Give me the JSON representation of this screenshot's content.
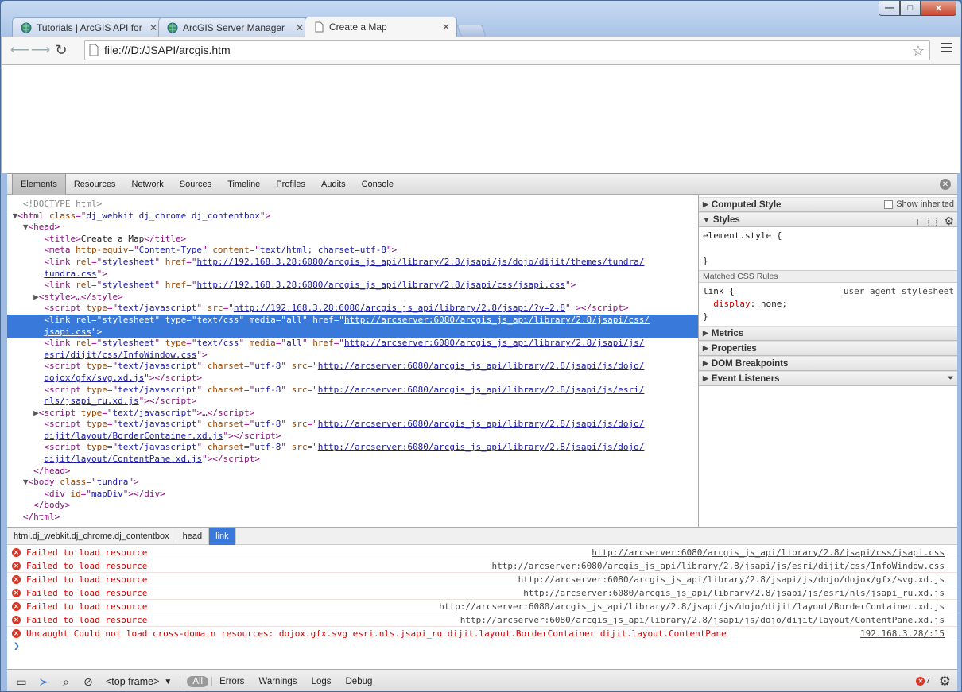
{
  "browser": {
    "tabs": [
      {
        "label": "Tutorials | ArcGIS API for J",
        "icon": "globe-icon",
        "active": false
      },
      {
        "label": "ArcGIS Server Manager",
        "icon": "globe-icon",
        "active": false
      },
      {
        "label": "Create a Map",
        "icon": "page-icon",
        "active": true
      }
    ],
    "url": "file:///D:/JSAPI/arcgis.htm"
  },
  "devtools": {
    "tabs": [
      "Elements",
      "Resources",
      "Network",
      "Sources",
      "Timeline",
      "Profiles",
      "Audits",
      "Console"
    ],
    "active_tab": "Elements",
    "dom": {
      "doctype": "<!DOCTYPE html>",
      "html_class": "dj_webkit dj_chrome dj_contentbox",
      "title": "Create a Map",
      "meta_equiv": "Content-Type",
      "meta_content": "text/html; charset=utf-8",
      "link1_a": "http://192.168.3.28:6080/arcgis_js_api/library/2.8/jsapi/js/dojo/dijit/themes/tundra/",
      "link1_b": "tundra.css",
      "link2": "http://192.168.3.28:6080/arcgis_js_api/library/2.8/jsapi/css/jsapi.css",
      "script1": "http://192.168.3.28:6080/arcgis_js_api/library/2.8/jsapi/?v=2.8",
      "sel_a": "http://arcserver:6080/arcgis_js_api/library/2.8/jsapi/css/",
      "sel_b": "jsapi.css",
      "link4_a": "http://arcserver:6080/arcgis_js_api/library/2.8/jsapi/js/",
      "link4_b": "esri/dijit/css/InfoWindow.css",
      "script2_a": "http://arcserver:6080/arcgis_js_api/library/2.8/jsapi/js/dojo/",
      "script2_b": "dojox/gfx/svg.xd.js",
      "script3_a": "http://arcserver:6080/arcgis_js_api/library/2.8/jsapi/js/esri/",
      "script3_b": "nls/jsapi_ru.xd.js",
      "script5_a": "http://arcserver:6080/arcgis_js_api/library/2.8/jsapi/js/dojo/",
      "script5_b": "dijit/layout/BorderContainer.xd.js",
      "script6_a": "http://arcserver:6080/arcgis_js_api/library/2.8/jsapi/js/dojo/",
      "script6_b": "dijit/layout/ContentPane.xd.js",
      "body_class": "tundra",
      "div_id": "mapDiv"
    },
    "sidebar": {
      "computed_style": "Computed Style",
      "show_inherited": "Show inherited",
      "styles": "Styles",
      "element_style": "element.style {",
      "close_brace": "}",
      "matched_css": "Matched CSS Rules",
      "rule_selector": "link {",
      "rule_origin": "user agent stylesheet",
      "rule_prop": "display",
      "rule_value": "none;",
      "panes": [
        "Metrics",
        "Properties",
        "DOM Breakpoints",
        "Event Listeners"
      ]
    },
    "breadcrumbs": [
      "html.dj_webkit.dj_chrome.dj_contentbox",
      "head",
      "link"
    ],
    "console": {
      "messages": [
        {
          "text": "Failed to load resource",
          "source": "http://arcserver:6080/arcgis_js_api/library/2.8/jsapi/css/jsapi.css"
        },
        {
          "text": "Failed to load resource",
          "source": "http://arcserver:6080/arcgis_js_api/library/2.8/jsapi/js/esri/dijit/css/InfoWindow.css"
        },
        {
          "text": "Failed to load resource",
          "source": "http://arcserver:6080/arcgis_js_api/library/2.8/jsapi/js/dojo/dojox/gfx/svg.xd.js"
        },
        {
          "text": "Failed to load resource",
          "source": "http://arcserver:6080/arcgis_js_api/library/2.8/jsapi/js/esri/nls/jsapi_ru.xd.js"
        },
        {
          "text": "Failed to load resource",
          "source": "http://arcserver:6080/arcgis_js_api/library/2.8/jsapi/js/dojo/dijit/layout/BorderContainer.xd.js"
        },
        {
          "text": "Failed to load resource",
          "source": "http://arcserver:6080/arcgis_js_api/library/2.8/jsapi/js/dojo/dijit/layout/ContentPane.xd.js"
        },
        {
          "text": "Uncaught Could not load cross-domain resources: dojox.gfx.svg esri.nls.jsapi_ru dijit.layout.BorderContainer dijit.layout.ContentPane",
          "source": "192.168.3.28/:15"
        }
      ]
    },
    "statusbar": {
      "frame": "<top frame>",
      "filters": [
        "All",
        "Errors",
        "Warnings",
        "Logs",
        "Debug"
      ],
      "error_count": "7"
    }
  }
}
